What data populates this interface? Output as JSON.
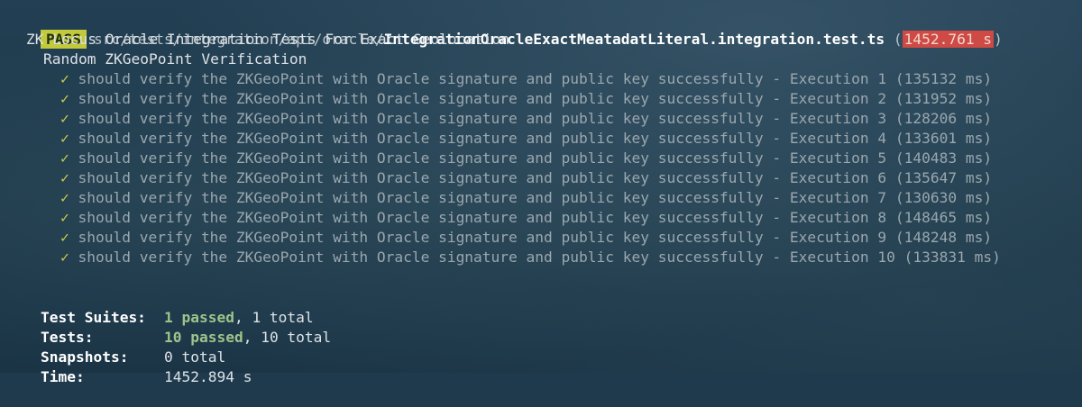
{
  "result": {
    "badge": "PASS",
    "path_dir": "src/tests/integration/api/oracle/",
    "file_name": "IntegrationOracleExactMeatadatLiteral.integration.test.ts",
    "open_paren": " (",
    "duration": "1452.761 s",
    "close_paren": ")"
  },
  "suite": {
    "title": "ZK Locus Oracle Integration Tests For Exact Geolocation",
    "group": "Random ZKGeoPoint Verification"
  },
  "check_glyph": "✓",
  "tests": [
    {
      "name": "should verify the ZKGeoPoint with Oracle signature and public key successfully - Execution 1",
      "time": "(135132 ms)"
    },
    {
      "name": "should verify the ZKGeoPoint with Oracle signature and public key successfully - Execution 2",
      "time": "(131952 ms)"
    },
    {
      "name": "should verify the ZKGeoPoint with Oracle signature and public key successfully - Execution 3",
      "time": "(128206 ms)"
    },
    {
      "name": "should verify the ZKGeoPoint with Oracle signature and public key successfully - Execution 4",
      "time": "(133601 ms)"
    },
    {
      "name": "should verify the ZKGeoPoint with Oracle signature and public key successfully - Execution 5",
      "time": "(140483 ms)"
    },
    {
      "name": "should verify the ZKGeoPoint with Oracle signature and public key successfully - Execution 6",
      "time": "(135647 ms)"
    },
    {
      "name": "should verify the ZKGeoPoint with Oracle signature and public key successfully - Execution 7",
      "time": "(130630 ms)"
    },
    {
      "name": "should verify the ZKGeoPoint with Oracle signature and public key successfully - Execution 8",
      "time": "(148465 ms)"
    },
    {
      "name": "should verify the ZKGeoPoint with Oracle signature and public key successfully - Execution 9",
      "time": "(148248 ms)"
    },
    {
      "name": "should verify the ZKGeoPoint with Oracle signature and public key successfully - Execution 10",
      "time": "(133831 ms)"
    }
  ],
  "summary": {
    "suites_label": "Test Suites:",
    "suites_passed": "1 passed",
    "suites_total": ", 1 total",
    "tests_label": "Tests:",
    "tests_passed": "10 passed",
    "tests_total": ", 10 total",
    "snapshots_label": "Snapshots:",
    "snapshots_value": "0 total",
    "time_label": "Time:",
    "time_value": "1452.894 s"
  },
  "colors": {
    "background": "#1f3a4d",
    "badge": "#c2c93d",
    "duration_highlight": "#cf4a44",
    "check": "#c9cc4a"
  }
}
